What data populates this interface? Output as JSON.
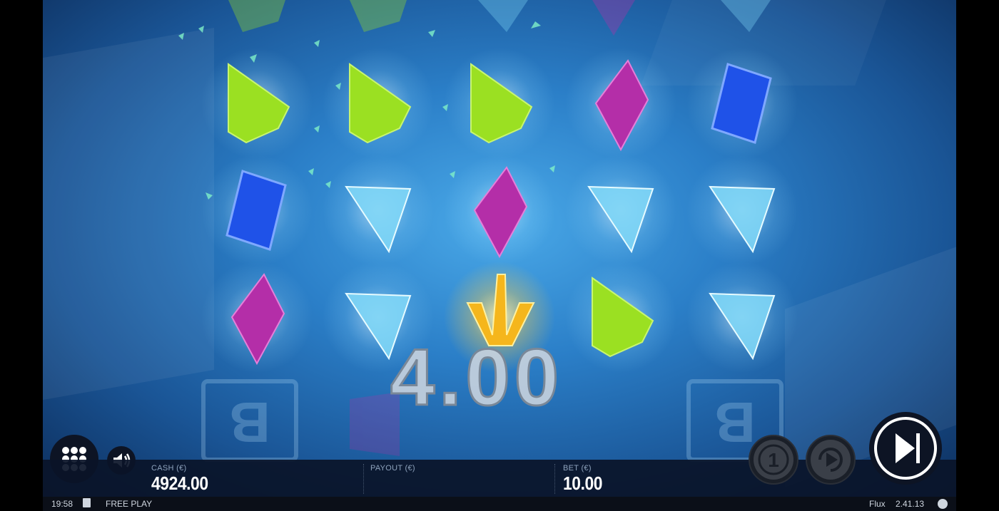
{
  "game": {
    "name": "Flux",
    "version": "2.41.13",
    "win_amount": "4.00",
    "grid": [
      [
        "green-gem",
        "green-gem",
        "green-gem",
        "purple-gem",
        "blue-gem"
      ],
      [
        "blue-gem",
        "cyan-gem",
        "purple-gem",
        "cyan-gem",
        "cyan-gem"
      ],
      [
        "purple-gem",
        "cyan-gem",
        "wild-symbol",
        "green-gem",
        "cyan-gem"
      ]
    ]
  },
  "meters": {
    "cash_label": "CASH (€)",
    "cash_value": "4924.00",
    "payout_label": "PAYOUT (€)",
    "payout_value": "",
    "bet_label": "BET (€)",
    "bet_value": "10.00"
  },
  "status": {
    "time": "19:58",
    "mode": "FREE PLAY"
  },
  "controls": {
    "menu_icon": "grid-icon",
    "sound_icon": "speaker-icon",
    "coin_icon": "coin-icon",
    "autoplay_icon": "autoplay-icon",
    "spin_icon": "skip-icon"
  },
  "colors": {
    "green": "#9be022",
    "purple": "#b42ea8",
    "blue": "#1f52e8",
    "cyan": "#7fd6f6",
    "gold": "#f5b61c"
  }
}
